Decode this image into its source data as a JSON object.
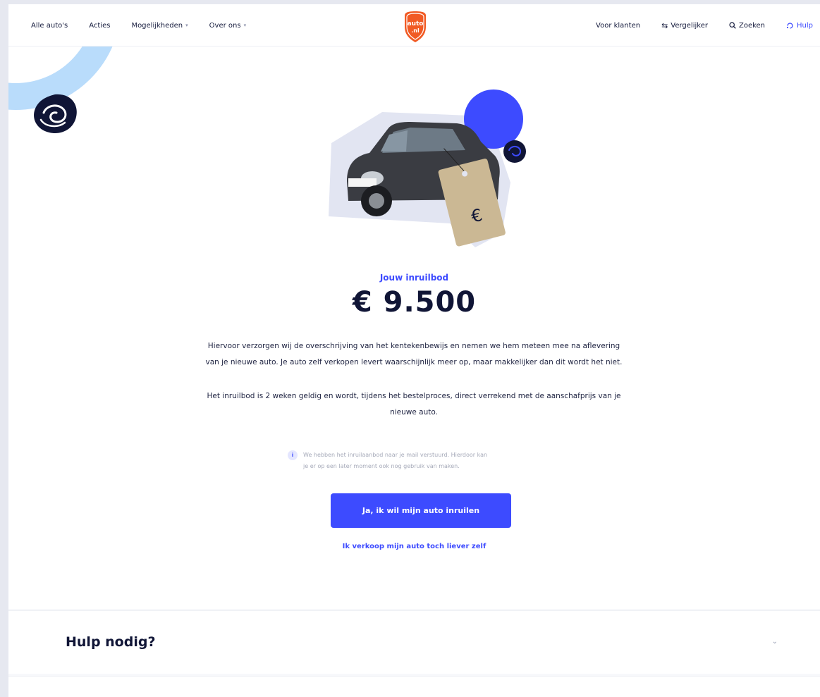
{
  "colors": {
    "accent": "#3d4bff",
    "dark_text": "#101536",
    "decor_light_blue": "#b9dcfb",
    "background": "#e6e8f0"
  },
  "header": {
    "logo_line1": "auto",
    "logo_line2": ".nl",
    "nav_left": [
      {
        "label": "Alle auto's"
      },
      {
        "label": "Acties"
      },
      {
        "label": "Mogelijkheden"
      },
      {
        "label": "Over ons"
      }
    ],
    "nav_right": {
      "customers": "Voor klanten",
      "compare": "Vergelijker",
      "search": "Zoeken",
      "help": "Hulp"
    },
    "icons": {
      "compare": "swap-arrows-icon",
      "search": "search-icon",
      "help": "help-icon"
    }
  },
  "hero": {
    "price_tag_symbol": "€"
  },
  "offer": {
    "label": "Jouw inruilbod",
    "amount": "€ 9.500",
    "paragraph1_line1": "Hiervoor verzorgen wij de overschrijving van het kentekenbewijs en nemen we hem meteen mee na aflevering",
    "paragraph1_line2": "van je nieuwe auto. Je auto zelf verkopen levert waarschijnlijk meer op, maar makkelijker dan dit wordt het niet.",
    "paragraph2_line1": "Het inruilbod is 2 weken geldig en wordt, tijdens het bestelproces, direct verrekend met de aanschafprijs van je",
    "paragraph2_line2": "nieuwe auto.",
    "info_icon": "i",
    "info_line1": "We hebben het inruilaanbod naar je mail verstuurd. Hierdoor kan",
    "info_line2": "je er op een later moment ook nog gebruik van maken.",
    "cta_label": "Ja, ik wil mijn auto inruilen",
    "secondary_label": "Ik verkoop mijn auto toch liever zelf"
  },
  "faq": {
    "title": "Hulp nodig?"
  }
}
